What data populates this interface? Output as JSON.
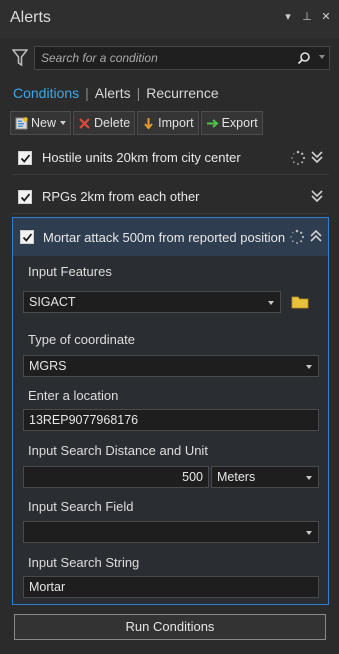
{
  "window": {
    "title": "Alerts",
    "controls": [
      "▾",
      "⊥",
      "✕"
    ]
  },
  "search": {
    "placeholder": "Search for a condition",
    "value": ""
  },
  "tabs": [
    {
      "label": "Conditions",
      "active": true
    },
    {
      "label": "Alerts",
      "active": false
    },
    {
      "label": "Recurrence",
      "active": false
    }
  ],
  "toolbar": {
    "new_label": "New",
    "delete_label": "Delete",
    "import_label": "Import",
    "export_label": "Export"
  },
  "conditions": [
    {
      "label": "Hostile units 20km from city center",
      "checked": true,
      "running": true,
      "expanded": false
    },
    {
      "label": "RPGs 2km from each other",
      "checked": true,
      "running": false,
      "expanded": false
    },
    {
      "label": "Mortar attack 500m from reported position",
      "checked": true,
      "running": true,
      "expanded": true
    }
  ],
  "form": {
    "input_features_label": "Input Features",
    "input_features_value": "SIGACT",
    "coord_type_label": "Type of coordinate",
    "coord_type_value": "MGRS",
    "location_label": "Enter a location",
    "location_value": "13REP9077968176",
    "distance_label": "Input Search Distance and Unit",
    "distance_value": "500",
    "unit_value": "Meters",
    "search_field_label": "Input Search Field",
    "search_field_value": "",
    "search_string_label": "Input Search String",
    "search_string_value": "Mortar"
  },
  "run_button": {
    "label": "Run Conditions"
  },
  "colors": {
    "accent": "#3fa6e8",
    "selected_border": "#2f7fd1",
    "delete": "#e04a3a",
    "import": "#e89a2c",
    "export": "#4cc24c",
    "folder": "#e8c23a"
  }
}
